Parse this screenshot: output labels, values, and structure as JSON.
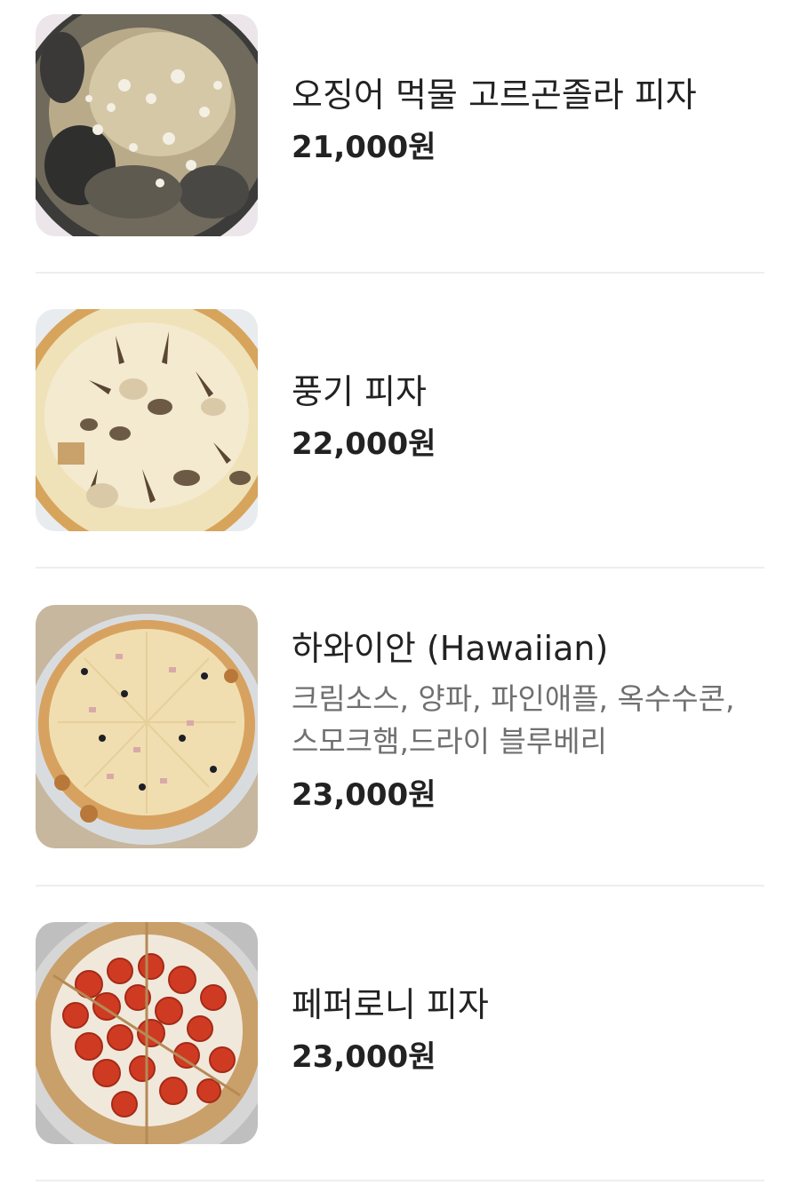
{
  "menu": {
    "items": [
      {
        "name": "오징어 먹물 고르곤졸라 피자",
        "description": "",
        "price": "21,000원",
        "image_icon": "squid-ink-gorgonzola-pizza-photo"
      },
      {
        "name": "풍기 피자",
        "description": "",
        "price": "22,000원",
        "image_icon": "funghi-pizza-photo"
      },
      {
        "name": "하와이안 (Hawaiian)",
        "description": "크림소스, 양파, 파인애플, 옥수수콘, 스모크햄,드라이 블루베리",
        "price": "23,000원",
        "image_icon": "hawaiian-pizza-photo"
      },
      {
        "name": "페퍼로니 피자",
        "description": "",
        "price": "23,000원",
        "image_icon": "pepperoni-pizza-photo"
      }
    ]
  },
  "colors": {
    "text_primary": "#222222",
    "text_secondary": "#707070",
    "divider": "#eeeeee"
  }
}
